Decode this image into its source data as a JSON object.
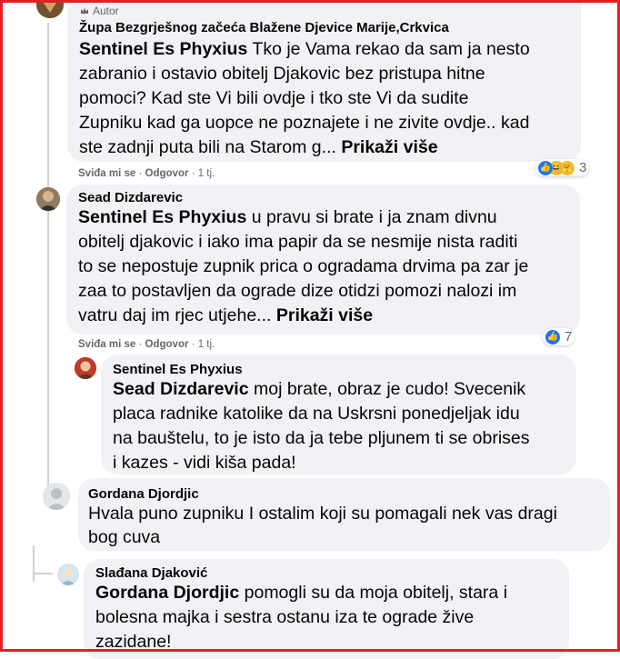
{
  "comments": [
    {
      "author_tag": "Autor",
      "author": "Župa Bezgrješnog začeća Blažene Djevice Marije,Crkvica",
      "mention": "Sentinel Es Phyxius",
      "text_lines": [
        "Tko je Vama rekao da sam ja nesto",
        "zabranio i ostavio obitelj Djakovic bez pristupa hitne",
        "pomoci? Kad ste Vi bili ovdje i tko ste Vi da sudite",
        "Zupniku kad ga uopce ne poznajete i ne zivite ovdje.. kad",
        "ste zadnji puta bili na Starom g..."
      ],
      "more": "Prikaži više",
      "like": "Sviđa mi se",
      "reply": "Odgovor",
      "time": "1 tj.",
      "reactions": {
        "icons": [
          "like-icon",
          "haha-icon",
          "care-icon"
        ],
        "count": "3"
      }
    },
    {
      "author": "Sead Dizdarevic",
      "mention": "Sentinel Es Phyxius",
      "text_lines": [
        "u pravu si brate i ja znam divnu",
        "obitelj djakovic i iako ima papir da se nesmije nista raditi",
        "to se nepostuje zupnik prica o ogradama drvima pa zar je",
        "zaa to postavljen da ograde dize otidzi pomozi nalozi im",
        "vatru daj im rjec utjehe..."
      ],
      "more": "Prikaži više",
      "like": "Sviđa mi se",
      "reply": "Odgovor",
      "time": "1 tj.",
      "reactions": {
        "icons": [
          "like-icon"
        ],
        "count": "7"
      }
    },
    {
      "author": "Sentinel Es Phyxius",
      "mention": "Sead Dizdarevic",
      "text_lines": [
        "moj brate, obraz je cudo! Svecenik",
        "placa radnike katolike da na Uskrsni ponedjeljak idu",
        "na bauštelu, to je isto da ja tebe pljunem ti se obrises",
        "i kazes - vidi kiša pada!"
      ]
    },
    {
      "author": "Gordana Djordjic",
      "text_lines": [
        "Hvala puno zupniku I ostalim koji su pomagali nek vas dragi",
        "bog cuva"
      ]
    },
    {
      "author": "Slađana Djaković",
      "mention": "Gordana Djordjic",
      "text_lines": [
        "pomogli su da moja obitelj, stara i",
        "bolesna majka i sestra ostanu iza te ograde žive",
        "zazidane!"
      ]
    }
  ],
  "colors": {
    "bubble": "#f0f2f5",
    "meta_text": "#65676b",
    "like_blue": "#1877f2",
    "frame_red": "#e41e26"
  }
}
